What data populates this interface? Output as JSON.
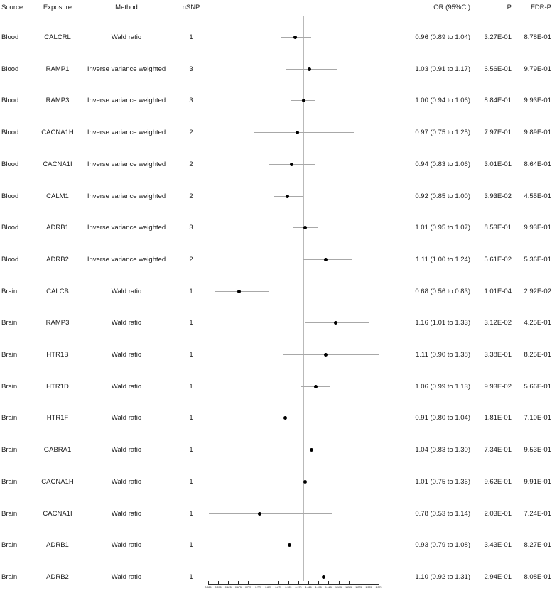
{
  "chart_data": {
    "type": "table",
    "title": "",
    "xlabel": "",
    "ylabel": "",
    "grid": false,
    "legend": "none",
    "reference_line": 1.0,
    "axis": {
      "min": 0.525,
      "max": 1.375,
      "tick_step": 0.05,
      "ticks": [
        "0.525",
        "0.575",
        "0.625",
        "0.675",
        "0.725",
        "0.775",
        "0.825",
        "0.875",
        "0.925",
        "0.975",
        "1.025",
        "1.075",
        "1.125",
        "1.175",
        "1.225",
        "1.275",
        "1.325",
        "1.375"
      ]
    },
    "columns": {
      "source": "Source",
      "exposure": "Exposure",
      "method": "Method",
      "nsnp": "nSNP",
      "or": "OR (95%CI)",
      "p": "P",
      "fdr": "FDR-P"
    },
    "rows": [
      {
        "source": "Blood",
        "exposure": "CALCRL",
        "method": "Wald ratio",
        "nsnp": "1",
        "or_text": "0.96 (0.89 to 1.04)",
        "or": 0.96,
        "lo": 0.89,
        "hi": 1.04,
        "p": "3.27E-01",
        "fdr": "8.78E-01"
      },
      {
        "source": "Blood",
        "exposure": "RAMP1",
        "method": "Inverse variance weighted",
        "nsnp": "3",
        "or_text": "1.03 (0.91 to 1.17)",
        "or": 1.03,
        "lo": 0.91,
        "hi": 1.17,
        "p": "6.56E-01",
        "fdr": "9.79E-01"
      },
      {
        "source": "Blood",
        "exposure": "RAMP3",
        "method": "Inverse variance weighted",
        "nsnp": "3",
        "or_text": "1.00 (0.94 to 1.06)",
        "or": 1.0,
        "lo": 0.94,
        "hi": 1.06,
        "p": "8.84E-01",
        "fdr": "9.93E-01"
      },
      {
        "source": "Blood",
        "exposure": "CACNA1H",
        "method": "Inverse variance weighted",
        "nsnp": "2",
        "or_text": "0.97 (0.75 to 1.25)",
        "or": 0.97,
        "lo": 0.75,
        "hi": 1.25,
        "p": "7.97E-01",
        "fdr": "9.89E-01"
      },
      {
        "source": "Blood",
        "exposure": "CACNA1I",
        "method": "Inverse variance weighted",
        "nsnp": "2",
        "or_text": "0.94 (0.83 to 1.06)",
        "or": 0.94,
        "lo": 0.83,
        "hi": 1.06,
        "p": "3.01E-01",
        "fdr": "8.64E-01"
      },
      {
        "source": "Blood",
        "exposure": "CALM1",
        "method": "Inverse variance weighted",
        "nsnp": "2",
        "or_text": "0.92 (0.85 to 1.00)",
        "or": 0.92,
        "lo": 0.85,
        "hi": 1.0,
        "p": "3.93E-02",
        "fdr": "4.55E-01"
      },
      {
        "source": "Blood",
        "exposure": "ADRB1",
        "method": "Inverse variance weighted",
        "nsnp": "3",
        "or_text": "1.01 (0.95 to 1.07)",
        "or": 1.01,
        "lo": 0.95,
        "hi": 1.07,
        "p": "8.53E-01",
        "fdr": "9.93E-01"
      },
      {
        "source": "Blood",
        "exposure": "ADRB2",
        "method": "Inverse variance weighted",
        "nsnp": "2",
        "or_text": "1.11 (1.00 to 1.24)",
        "or": 1.11,
        "lo": 1.0,
        "hi": 1.24,
        "p": "5.61E-02",
        "fdr": "5.36E-01"
      },
      {
        "source": "Brain",
        "exposure": "CALCB",
        "method": "Wald ratio",
        "nsnp": "1",
        "or_text": "0.68 (0.56 to 0.83)",
        "or": 0.68,
        "lo": 0.56,
        "hi": 0.83,
        "p": "1.01E-04",
        "fdr": "2.92E-02"
      },
      {
        "source": "Brain",
        "exposure": "RAMP3",
        "method": "Wald ratio",
        "nsnp": "1",
        "or_text": "1.16 (1.01 to 1.33)",
        "or": 1.16,
        "lo": 1.01,
        "hi": 1.33,
        "p": "3.12E-02",
        "fdr": "4.25E-01"
      },
      {
        "source": "Brain",
        "exposure": "HTR1B",
        "method": "Wald ratio",
        "nsnp": "1",
        "or_text": "1.11 (0.90 to 1.38)",
        "or": 1.11,
        "lo": 0.9,
        "hi": 1.38,
        "p": "3.38E-01",
        "fdr": "8.25E-01"
      },
      {
        "source": "Brain",
        "exposure": "HTR1D",
        "method": "Wald ratio",
        "nsnp": "1",
        "or_text": "1.06 (0.99 to 1.13)",
        "or": 1.06,
        "lo": 0.99,
        "hi": 1.13,
        "p": "9.93E-02",
        "fdr": "5.66E-01"
      },
      {
        "source": "Brain",
        "exposure": "HTR1F",
        "method": "Wald ratio",
        "nsnp": "1",
        "or_text": "0.91 (0.80 to 1.04)",
        "or": 0.91,
        "lo": 0.8,
        "hi": 1.04,
        "p": "1.81E-01",
        "fdr": "7.10E-01"
      },
      {
        "source": "Brain",
        "exposure": "GABRA1",
        "method": "Wald ratio",
        "nsnp": "1",
        "or_text": "1.04 (0.83 to 1.30)",
        "or": 1.04,
        "lo": 0.83,
        "hi": 1.3,
        "p": "7.34E-01",
        "fdr": "9.53E-01"
      },
      {
        "source": "Brain",
        "exposure": "CACNA1H",
        "method": "Wald ratio",
        "nsnp": "1",
        "or_text": "1.01 (0.75 to 1.36)",
        "or": 1.01,
        "lo": 0.75,
        "hi": 1.36,
        "p": "9.62E-01",
        "fdr": "9.91E-01"
      },
      {
        "source": "Brain",
        "exposure": "CACNA1I",
        "method": "Wald ratio",
        "nsnp": "1",
        "or_text": "0.78 (0.53 to 1.14)",
        "or": 0.78,
        "lo": 0.53,
        "hi": 1.14,
        "p": "2.03E-01",
        "fdr": "7.24E-01"
      },
      {
        "source": "Brain",
        "exposure": "ADRB1",
        "method": "Wald ratio",
        "nsnp": "1",
        "or_text": "0.93 (0.79 to 1.08)",
        "or": 0.93,
        "lo": 0.79,
        "hi": 1.08,
        "p": "3.43E-01",
        "fdr": "8.27E-01"
      },
      {
        "source": "Brain",
        "exposure": "ADRB2",
        "method": "Wald ratio",
        "nsnp": "1",
        "or_text": "1.10 (0.92 to 1.31)",
        "or": 1.1,
        "lo": 0.92,
        "hi": 1.31,
        "p": "2.94E-01",
        "fdr": "8.08E-01"
      }
    ]
  },
  "colors": {
    "point": "#000000",
    "ci": "#a8a8a8",
    "reference": "#b9b9b9",
    "axis": "#2b2b2b",
    "text": "#1a1a1a"
  }
}
